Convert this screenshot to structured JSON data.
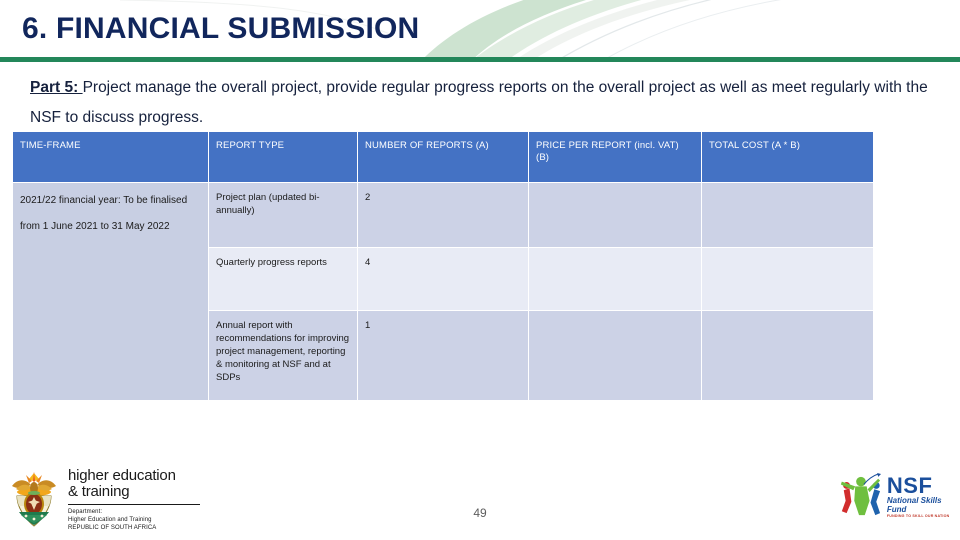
{
  "slide": {
    "title": "6. FINANCIAL SUBMISSION",
    "page_number": "49",
    "accent_green": "#23875a",
    "title_navy": "#11265c",
    "table_header_blue": "#4472c4",
    "row_dark": "#ccd2e6",
    "row_light": "#e8ebf5"
  },
  "intro": {
    "lead": "Part 5: ",
    "body": "Project manage the overall project, provide regular progress reports on the overall project as well as meet regularly with the NSF to discuss progress."
  },
  "table": {
    "headers": [
      "TIME-FRAME",
      "REPORT TYPE",
      "NUMBER OF REPORTS (A)",
      "PRICE PER REPORT (incl. VAT) (B)",
      "TOTAL COST (A * B)"
    ],
    "timeframe": "2021/22 financial year: To be finalised from 1 June 2021 to 31 May 2022",
    "rows": [
      {
        "report_type": "Project plan (updated bi-annually)",
        "number_of_reports": "2",
        "price_per_report": "",
        "total_cost": ""
      },
      {
        "report_type": "Quarterly progress reports",
        "number_of_reports": "4",
        "price_per_report": "",
        "total_cost": ""
      },
      {
        "report_type": "Annual report with recommendations for improving project management, reporting & monitoring at NSF and at SDPs",
        "number_of_reports": "1",
        "price_per_report": "",
        "total_cost": ""
      }
    ]
  },
  "footer": {
    "dhet": {
      "line1": "higher education",
      "line2": "& training",
      "sub1": "Department:",
      "sub2": "Higher Education and Training",
      "sub3": "REPUBLIC OF SOUTH AFRICA"
    },
    "nsf": {
      "abbr": "NSF",
      "full_name": "National Skills Fund",
      "tagline": "FUNDING TO SKILL OUR NATION"
    }
  }
}
